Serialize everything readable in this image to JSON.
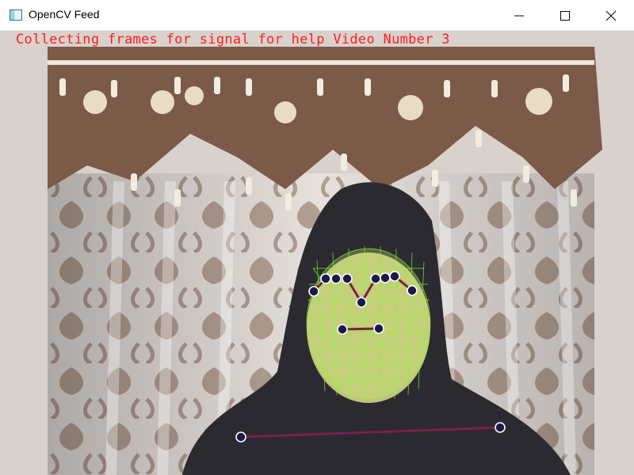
{
  "window": {
    "title": "OpenCV Feed",
    "icon": "opencv-window-icon",
    "controls": [
      "minimize-icon",
      "maximize-icon",
      "close-icon"
    ]
  },
  "feed": {
    "overlay_text": "Collecting frames for signal for help Video Number 3",
    "overlay_color": "#ff1e1e",
    "mesh_color": "#7cff2e",
    "pose_color": "#7a1f4a",
    "landmark_color": "#1a1a4a"
  }
}
